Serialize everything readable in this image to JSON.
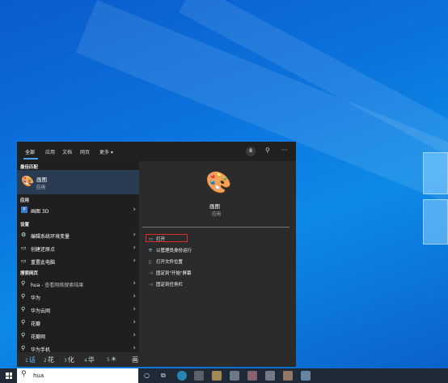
{
  "tabs": [
    "全部",
    "应用",
    "文档",
    "网页",
    "更多 ▾"
  ],
  "badge": "8",
  "sections": {
    "best_match": "最佳匹配",
    "apps": "应用",
    "settings": "设置",
    "web": "搜索网页"
  },
  "best_match": {
    "title": "画图",
    "subtitle": "应用"
  },
  "apps": [
    {
      "label": "画图 3D"
    }
  ],
  "settings": [
    {
      "label": "编辑系统环境变量"
    },
    {
      "label": "创建还原点"
    },
    {
      "label": "重置此电脑"
    }
  ],
  "web": [
    {
      "label": "hua",
      "sub": " - 查看网络搜索结果"
    },
    {
      "label": "华为"
    },
    {
      "label": "华为云网"
    },
    {
      "label": "花瓣"
    },
    {
      "label": "花瓣网"
    },
    {
      "label": "华为手机"
    }
  ],
  "preview": {
    "title": "画图",
    "subtitle": "应用"
  },
  "actions": [
    {
      "icon": "open-icon",
      "label": "打开"
    },
    {
      "icon": "admin-icon",
      "label": "以管理员身份运行"
    },
    {
      "icon": "folder-icon",
      "label": "打开文件位置"
    },
    {
      "icon": "pin-icon",
      "label": "固定到\"开始\"屏幕"
    },
    {
      "icon": "pin-icon",
      "label": "固定到任务栏"
    }
  ],
  "ime_candidates": [
    {
      "n": "1",
      "text": "话"
    },
    {
      "n": "2",
      "text": "花"
    },
    {
      "n": "3",
      "text": "化"
    },
    {
      "n": "4",
      "text": "华"
    },
    {
      "n": "5",
      "text": "☀"
    },
    {
      "n": "",
      "text": "画"
    }
  ],
  "search": {
    "value": "hua"
  },
  "colors": {
    "accent": "#4aa0f0",
    "highlight": "#e02b2b",
    "selected_bg": "#2a3b52"
  }
}
